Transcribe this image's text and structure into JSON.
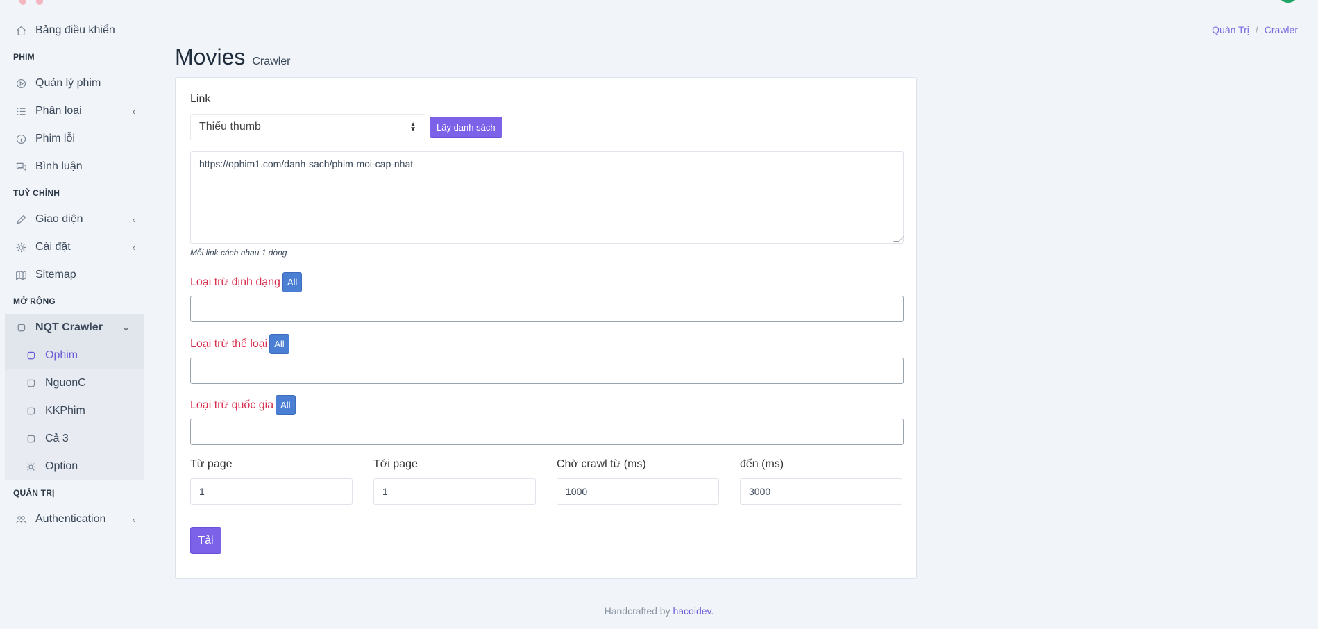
{
  "sidebar": {
    "dashboard": "Bảng điều khiển",
    "h_phim": "PHIM",
    "quanly": "Quản lý phim",
    "phanloai": "Phân loại",
    "phimloi": "Phim lỗi",
    "binhluan": "Bình luận",
    "h_tuychinh": "TUỲ CHỈNH",
    "giaodien": "Giao diện",
    "caidat": "Cài đặt",
    "sitemap": "Sitemap",
    "h_morong": "MỞ RỘNG",
    "crawler": "NQT Crawler",
    "ophim": "Ophim",
    "nguonc": "NguonC",
    "kkphim": "KKPhim",
    "ca3": "Cả 3",
    "option": "Option",
    "h_quantri": "QUẢN TRỊ",
    "auth": "Authentication"
  },
  "header": {
    "title": "Movies",
    "subtitle": "Crawler"
  },
  "breadcrumb": {
    "root": "Quản Trị",
    "sep": "/",
    "current": "Crawler"
  },
  "form": {
    "link_label": "Link",
    "select_value": "Thiếu thumb",
    "fetch_button": "Lấy danh sách",
    "textarea_value": "https://ophim1.com/danh-sach/phim-moi-cap-nhat",
    "hint": "Mỗi link cách nhau 1 dòng",
    "exclude_format": "Loại trừ định dạng",
    "exclude_genre": "Loại trừ thể loại",
    "exclude_country": "Loại trừ quốc gia",
    "all_label": "All",
    "from_page_label": "Từ page",
    "from_page": "1",
    "to_page_label": "Tới page",
    "to_page": "1",
    "wait_from_label": "Chờ crawl từ (ms)",
    "wait_from": "1000",
    "wait_to_label": "đến (ms)",
    "wait_to": "3000",
    "submit": "Tải"
  },
  "footer": {
    "text": "Handcrafted by",
    "author": "hacoidev."
  }
}
